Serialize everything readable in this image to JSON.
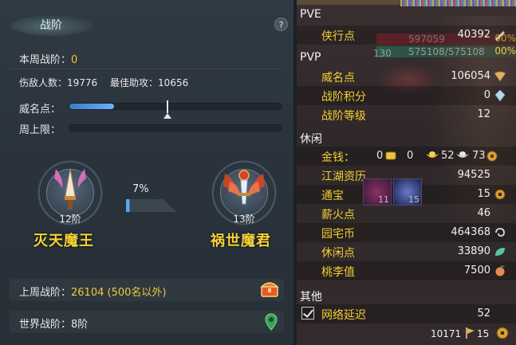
{
  "left": {
    "title": "战阶",
    "help": "?",
    "weekly_label": "本周战阶：",
    "weekly_value": "0",
    "injured_label": "伤敌人数：",
    "injured_value": "19776",
    "best_assist_label": "最佳助攻：",
    "best_assist_value": "10656",
    "prestige_label": "威名点：",
    "prestige_fill": 0.21,
    "weekly_cap_label": "周上限：",
    "weekly_cap_fill": 0,
    "progress_pct": "7%",
    "current_rank": {
      "level": "12阶",
      "name": "灭天魔王"
    },
    "next_rank": {
      "level": "13阶",
      "name": "祸世魔君"
    },
    "last_week_label": "上周战阶：",
    "last_week_value": "26104 (500名以外)",
    "world_label": "世界战阶：",
    "world_value": "8阶"
  },
  "right": {
    "sections": {
      "pve": "PVE",
      "pvp": "PVP",
      "leisure": "休闲",
      "other": "其他"
    },
    "pve": [
      {
        "label": "侠行点",
        "value": "40392",
        "icon": "pen-icon"
      }
    ],
    "overlay": {
      "hp": "597059",
      "mp": "575108/575108",
      "pct_top": "00%",
      "pct_bottom": "00%",
      "level": "130"
    },
    "pvp": [
      {
        "label": "威名点",
        "value": "106054",
        "icon": "fan-icon"
      },
      {
        "label": "战阶积分",
        "value": "0",
        "icon": "crystal-icon"
      },
      {
        "label": "战阶等级",
        "value": "12",
        "icon": ""
      }
    ],
    "gold": {
      "label": "金钱：",
      "v1": "0",
      "v2": "0",
      "v3": "52",
      "v4": "73"
    },
    "leisure": [
      {
        "label": "江湖资历",
        "value": "94525",
        "icon": ""
      },
      {
        "label": "通宝",
        "value": "15",
        "icon": "coin-icon"
      },
      {
        "label": "薪火点",
        "value": "46",
        "icon": ""
      },
      {
        "label": "园宅币",
        "value": "464368",
        "icon": "swirl-icon"
      },
      {
        "label": "休闲点",
        "value": "33890",
        "icon": "leaf-icon"
      },
      {
        "label": "桃李值",
        "value": "7500",
        "icon": "peach-icon"
      }
    ],
    "tongbao_counts": {
      "c1": "11",
      "c2": "15"
    },
    "other": [
      {
        "label": "网络延迟",
        "value": "52"
      }
    ],
    "footer": {
      "n1": "10171",
      "n2": "15"
    }
  },
  "colors": {
    "accent_yellow": "#f0c83a",
    "bar_blue": "#5aa6f5",
    "left_bg": "#2c353e",
    "right_bg": "#322a2b"
  }
}
